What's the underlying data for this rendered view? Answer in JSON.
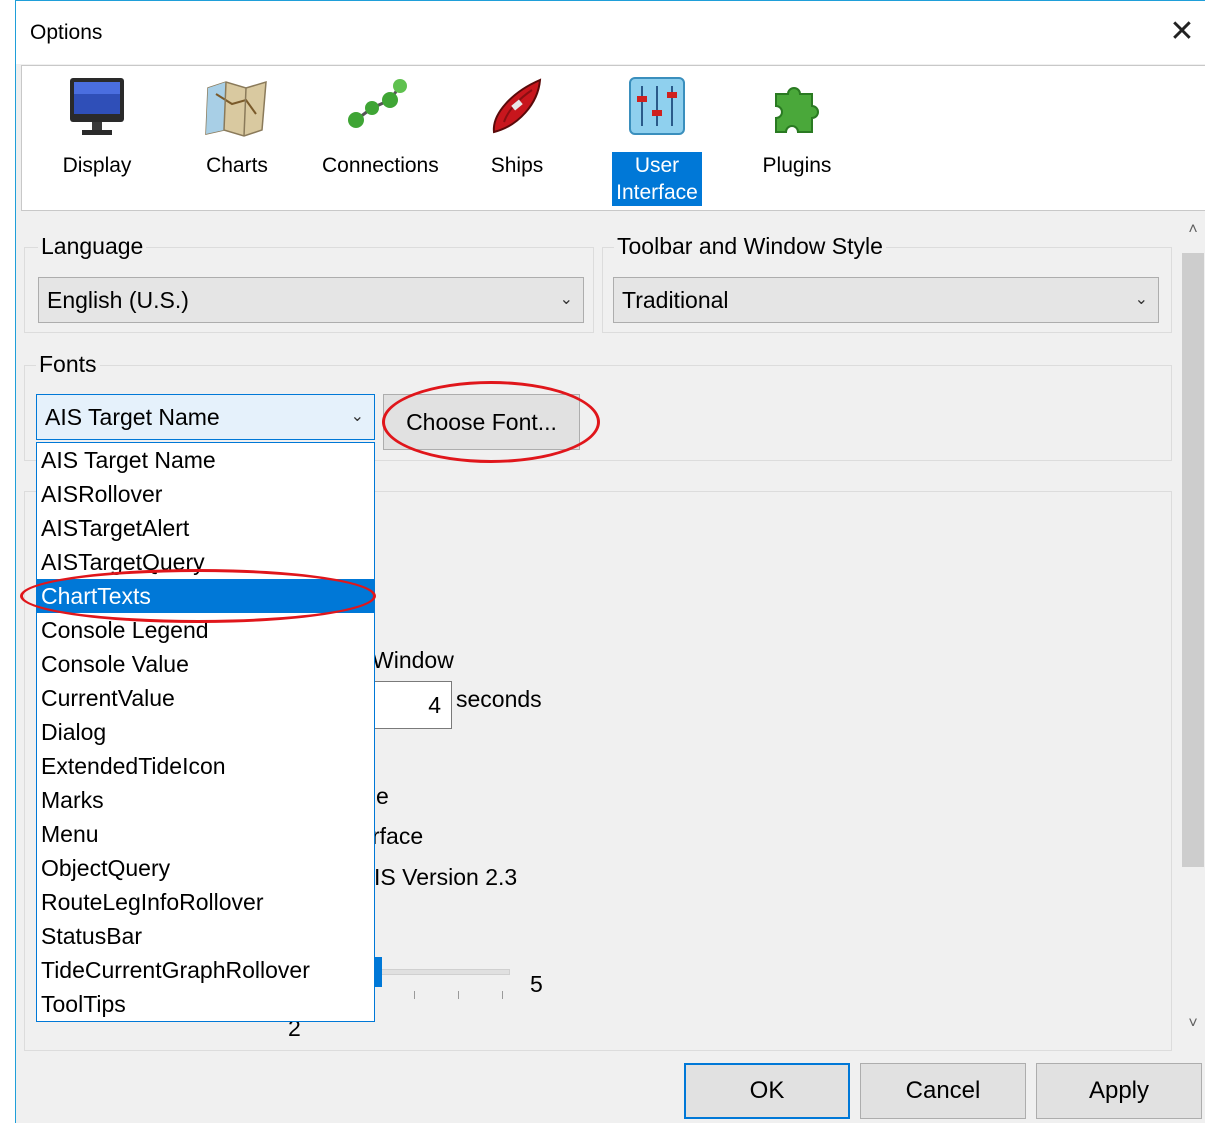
{
  "window": {
    "title": "Options",
    "close_glyph": "✕"
  },
  "toolbar": {
    "items": [
      {
        "label": "Display",
        "icon": "monitor-icon"
      },
      {
        "label": "Charts",
        "icon": "chart-map-icon"
      },
      {
        "label": "Connections",
        "icon": "connections-icon"
      },
      {
        "label": "Ships",
        "icon": "ship-icon"
      },
      {
        "label": "User Interface",
        "icon": "sliders-icon"
      },
      {
        "label": "Plugins",
        "icon": "puzzle-icon"
      }
    ],
    "selected": "User Interface"
  },
  "language": {
    "group_label": "Language",
    "value": "English (U.S.)"
  },
  "toolbar_style": {
    "group_label": "Toolbar and Window Style",
    "value": "Traditional"
  },
  "fonts": {
    "group_label": "Fonts",
    "selected_value": "AIS Target Name",
    "choose_button": "Choose Font...",
    "options": [
      "AIS Target Name",
      "AISRollover",
      "AISTargetAlert",
      "AISTargetQuery",
      "ChartTexts",
      "Console Legend",
      "Console Value",
      "CurrentValue",
      "Dialog",
      "ExtendedTideIcon",
      "Marks",
      "Menu",
      "ObjectQuery",
      "RouteLegInfoRollover",
      "StatusBar",
      "TideCurrentGraphRollover",
      "ToolTips"
    ],
    "highlighted": "ChartTexts"
  },
  "background": {
    "window_text": "Window",
    "seconds_value": "4",
    "seconds_label": "seconds",
    "partial_e": "e",
    "interface_text": "rface",
    "version_text": "IS Version 2.3",
    "slider_max": "5",
    "slider_value": "2"
  },
  "buttons": {
    "ok": "OK",
    "cancel": "Cancel",
    "apply": "Apply"
  },
  "scroll": {
    "up": "˄",
    "down": "˅"
  },
  "colors": {
    "accent": "#0078d7",
    "annotation": "#e0161b"
  }
}
